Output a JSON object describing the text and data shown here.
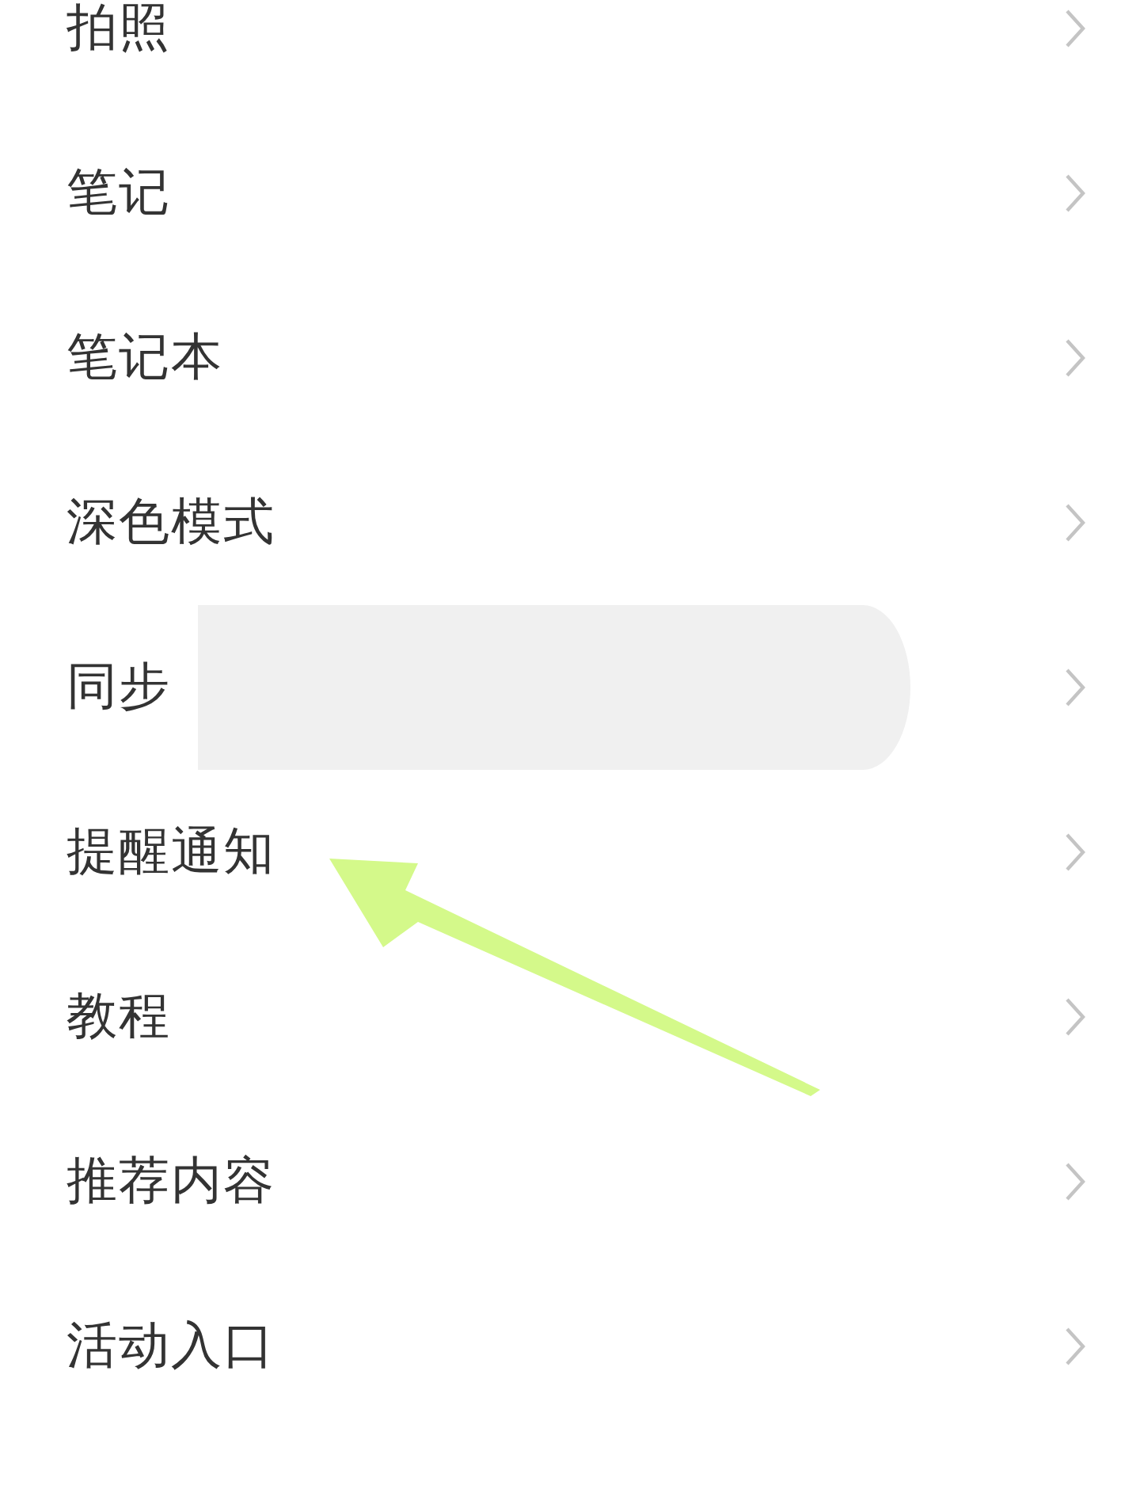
{
  "settings_list": [
    {
      "label": "拍照"
    },
    {
      "label": "笔记"
    },
    {
      "label": "笔记本"
    },
    {
      "label": "深色模式"
    },
    {
      "label": "同步"
    },
    {
      "label": "提醒通知"
    },
    {
      "label": "教程"
    },
    {
      "label": "推荐内容"
    },
    {
      "label": "活动入口"
    }
  ],
  "redaction": {
    "kind": "block"
  },
  "annotation": {
    "kind": "arrow"
  }
}
